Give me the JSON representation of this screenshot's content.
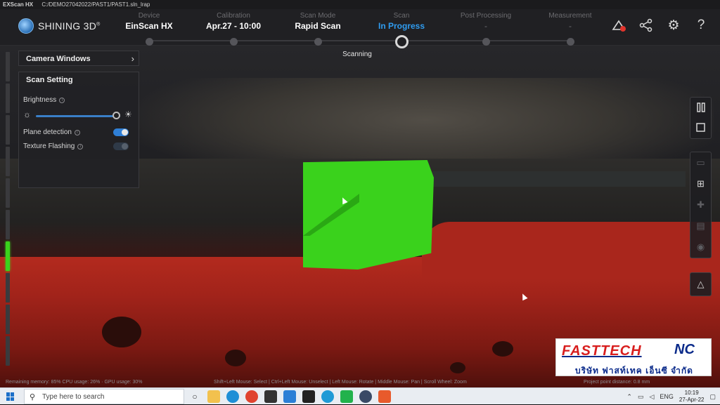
{
  "window": {
    "app_name": "EXScan HX",
    "file_path": "C:/DEMO27042022/PAST1/PAST1.sln_lrap"
  },
  "brand": {
    "name": "SHINING 3D",
    "trademark": "®"
  },
  "steps": [
    {
      "label": "Device",
      "value": "EinScan HX",
      "state": "done"
    },
    {
      "label": "Calibration",
      "value": "Apr.27 - 10:00",
      "state": "done"
    },
    {
      "label": "Scan Mode",
      "value": "Rapid Scan",
      "state": "done"
    },
    {
      "label": "Scan",
      "value": "In Progress",
      "state": "active"
    },
    {
      "label": "Post Processing",
      "value": "-",
      "state": "pending"
    },
    {
      "label": "Measurement",
      "value": "-",
      "state": "pending"
    }
  ],
  "top_icons": [
    "scanner-alert-icon",
    "share-icon",
    "settings-gear-icon",
    "help-icon"
  ],
  "scan_status": "Scanning",
  "camera_panel": {
    "title": "Camera Windows"
  },
  "scan_setting": {
    "title": "Scan Setting",
    "brightness_label": "Brightness",
    "brightness_level": 0.95,
    "plane_detection_label": "Plane detection",
    "plane_detection": true,
    "texture_flashing_label": "Texture Flashing",
    "texture_flashing": false
  },
  "right_toolbar": {
    "group1": [
      "pause-icon",
      "stop-icon"
    ],
    "group2": [
      "layer-icon",
      "clear-icon",
      "puzzle-icon",
      "save-icon",
      "view-icon"
    ],
    "group3": [
      "mesh-icon"
    ]
  },
  "status_bar": {
    "memory": "Remaining memory: 85% CPU usage: 26% · GPU usage: 30%",
    "hints": "Shift+Left Mouse: Select | Ctrl+Left Mouse: Unselect | Left Mouse: Rotate | Middle Mouse: Pan | Scroll Wheel: Zoom",
    "point_distance": "Project point distance: 0.8 mm"
  },
  "watermark": {
    "name": "FASTTECH",
    "suffix": "NC",
    "thai": "บริษัท  ฟาสท์เทค  เอ็นซี  จำกัด"
  },
  "taskbar": {
    "search_placeholder": "Type here to search",
    "language": "ENG",
    "time": "10:19",
    "date": "27-Apr-22"
  },
  "colors": {
    "accent": "#2f9cf0",
    "scan_green": "#3ad21c",
    "part_red": "#b32a1e"
  }
}
